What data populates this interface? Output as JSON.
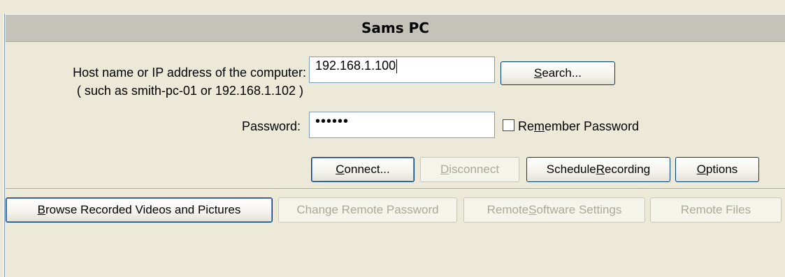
{
  "window": {
    "title": "Sams PC"
  },
  "host": {
    "label": "Host name or IP address of the computer:",
    "hint": "( such as smith-pc-01 or 192.168.1.102 )",
    "value": "192.168.1.100"
  },
  "password": {
    "label": "Password:",
    "masked_value": "••••••"
  },
  "buttons": {
    "search": {
      "pre": "",
      "key": "S",
      "post": "earch..."
    },
    "connect": {
      "pre": "",
      "key": "C",
      "post": "onnect..."
    },
    "disconnect": {
      "pre": "",
      "key": "D",
      "post": "isconnect"
    },
    "schedule": {
      "pre": "Schedule ",
      "key": "R",
      "post": "ecording"
    },
    "options": {
      "pre": "",
      "key": "O",
      "post": "ptions"
    }
  },
  "remember": {
    "pre": "Re",
    "key": "m",
    "post": "ember Password",
    "checked": false
  },
  "bottom_buttons": {
    "browse": {
      "pre": "",
      "key": "B",
      "post": "rowse Recorded Videos and Pictures"
    },
    "change_password": {
      "pre": "Change Remote Password",
      "key": "",
      "post": ""
    },
    "remote_settings": {
      "pre": "Remote ",
      "key": "S",
      "post": "oftware Settings"
    },
    "remote_files": {
      "pre": "Remote Files",
      "key": "",
      "post": ""
    }
  }
}
